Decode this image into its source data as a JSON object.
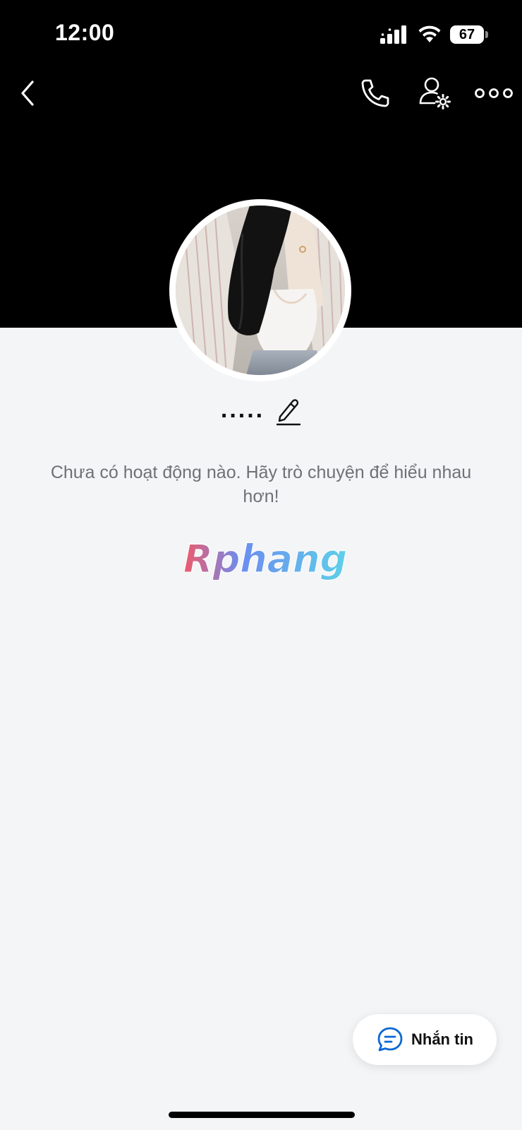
{
  "status_bar": {
    "time": "12:00",
    "battery": "67"
  },
  "header": {
    "back_icon": "chevron-left-icon",
    "call_icon": "phone-icon",
    "settings_icon": "user-gear-icon",
    "more_icon": "ellipsis-icon"
  },
  "profile": {
    "display_name": ".....",
    "edit_icon": "pencil-icon"
  },
  "empty_state": {
    "message": "Chưa có hoạt động nào. Hãy trò chuyện để hiểu nhau hơn!"
  },
  "watermark": {
    "text": "Rphang"
  },
  "message_button": {
    "label": "Nhắn tin",
    "icon": "chat-bubble-icon",
    "accent_color": "#0a68d4"
  },
  "colors": {
    "cover_background": "#000000",
    "page_background": "#f4f5f7",
    "secondary_text": "#6e7175"
  }
}
